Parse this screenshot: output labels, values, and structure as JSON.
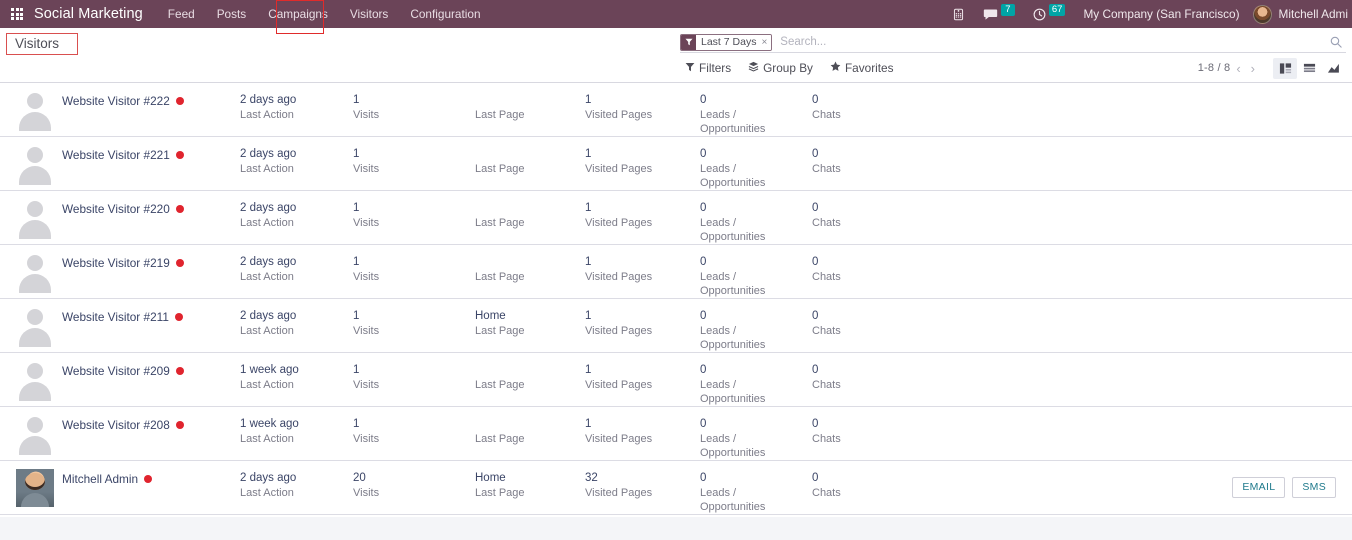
{
  "navbar": {
    "apps_icon": "apps-grid-icon",
    "brand": "Social Marketing",
    "menu": [
      {
        "label": "Feed"
      },
      {
        "label": "Posts"
      },
      {
        "label": "Campaigns"
      },
      {
        "label": "Visitors"
      },
      {
        "label": "Configuration"
      }
    ],
    "phone_icon": "phone-icon",
    "messages": {
      "icon": "chat-bubble-icon",
      "count": "7"
    },
    "activities": {
      "icon": "clock-icon",
      "count": "67"
    },
    "company": "My Company (San Francisco)",
    "user": "Mitchell Admi"
  },
  "control_panel": {
    "breadcrumb": "Visitors",
    "search": {
      "facet_icon": "filter-funnel-icon",
      "facet_label": "Last 7 Days",
      "facet_close": "×",
      "placeholder": "Search...",
      "value": "",
      "search_icon": "search-icon"
    },
    "dropdowns": [
      {
        "label": "Filters",
        "icon": "funnel-icon",
        "glyph": "▼"
      },
      {
        "label": "Group By",
        "icon": "layers-icon",
        "glyph": "☲"
      },
      {
        "label": "Favorites",
        "icon": "star-icon",
        "glyph": "★"
      }
    ],
    "pager": {
      "value": "1-8 / 8",
      "prev": "‹",
      "next": "›"
    },
    "views": [
      {
        "name": "kanban-view",
        "active": true
      },
      {
        "name": "list-view",
        "active": false
      },
      {
        "name": "graph-view",
        "active": false
      }
    ]
  },
  "labels": {
    "last_action": "Last Action",
    "visits": "Visits",
    "last_page": "Last Page",
    "visited_pages": "Visited Pages",
    "leads": "Leads / Opportunities",
    "chats": "Chats"
  },
  "rows": [
    {
      "name": "Website Visitor #222",
      "avatar": "placeholder",
      "status": "offline",
      "last_action": "2 days ago",
      "visits": "1",
      "last_page": "",
      "visited_pages": "1",
      "leads": "0",
      "chats": "0",
      "actions": []
    },
    {
      "name": "Website Visitor #221",
      "avatar": "placeholder",
      "status": "offline",
      "last_action": "2 days ago",
      "visits": "1",
      "last_page": "",
      "visited_pages": "1",
      "leads": "0",
      "chats": "0",
      "actions": []
    },
    {
      "name": "Website Visitor #220",
      "avatar": "placeholder",
      "status": "offline",
      "last_action": "2 days ago",
      "visits": "1",
      "last_page": "",
      "visited_pages": "1",
      "leads": "0",
      "chats": "0",
      "actions": []
    },
    {
      "name": "Website Visitor #219",
      "avatar": "placeholder",
      "status": "offline",
      "last_action": "2 days ago",
      "visits": "1",
      "last_page": "",
      "visited_pages": "1",
      "leads": "0",
      "chats": "0",
      "actions": []
    },
    {
      "name": "Website Visitor #211",
      "avatar": "placeholder",
      "status": "offline",
      "last_action": "2 days ago",
      "visits": "1",
      "last_page": "Home",
      "visited_pages": "1",
      "leads": "0",
      "chats": "0",
      "actions": []
    },
    {
      "name": "Website Visitor #209",
      "avatar": "placeholder",
      "status": "offline",
      "last_action": "1 week ago",
      "visits": "1",
      "last_page": "",
      "visited_pages": "1",
      "leads": "0",
      "chats": "0",
      "actions": []
    },
    {
      "name": "Website Visitor #208",
      "avatar": "placeholder",
      "status": "offline",
      "last_action": "1 week ago",
      "visits": "1",
      "last_page": "",
      "visited_pages": "1",
      "leads": "0",
      "chats": "0",
      "actions": []
    },
    {
      "name": "Mitchell Admin",
      "avatar": "photo",
      "status": "offline",
      "last_action": "2 days ago",
      "visits": "20",
      "last_page": "Home",
      "visited_pages": "32",
      "leads": "0",
      "chats": "0",
      "actions": [
        "EMAIL",
        "SMS"
      ]
    }
  ],
  "colors": {
    "navbar_bg": "#6b4458",
    "badge_bg": "#00a4a6",
    "status_offline": "#e0242e",
    "annotation": "#e02b2b",
    "action_text": "#1f7a8c",
    "value_text": "#3b4567",
    "label_text": "#7c7c89"
  }
}
